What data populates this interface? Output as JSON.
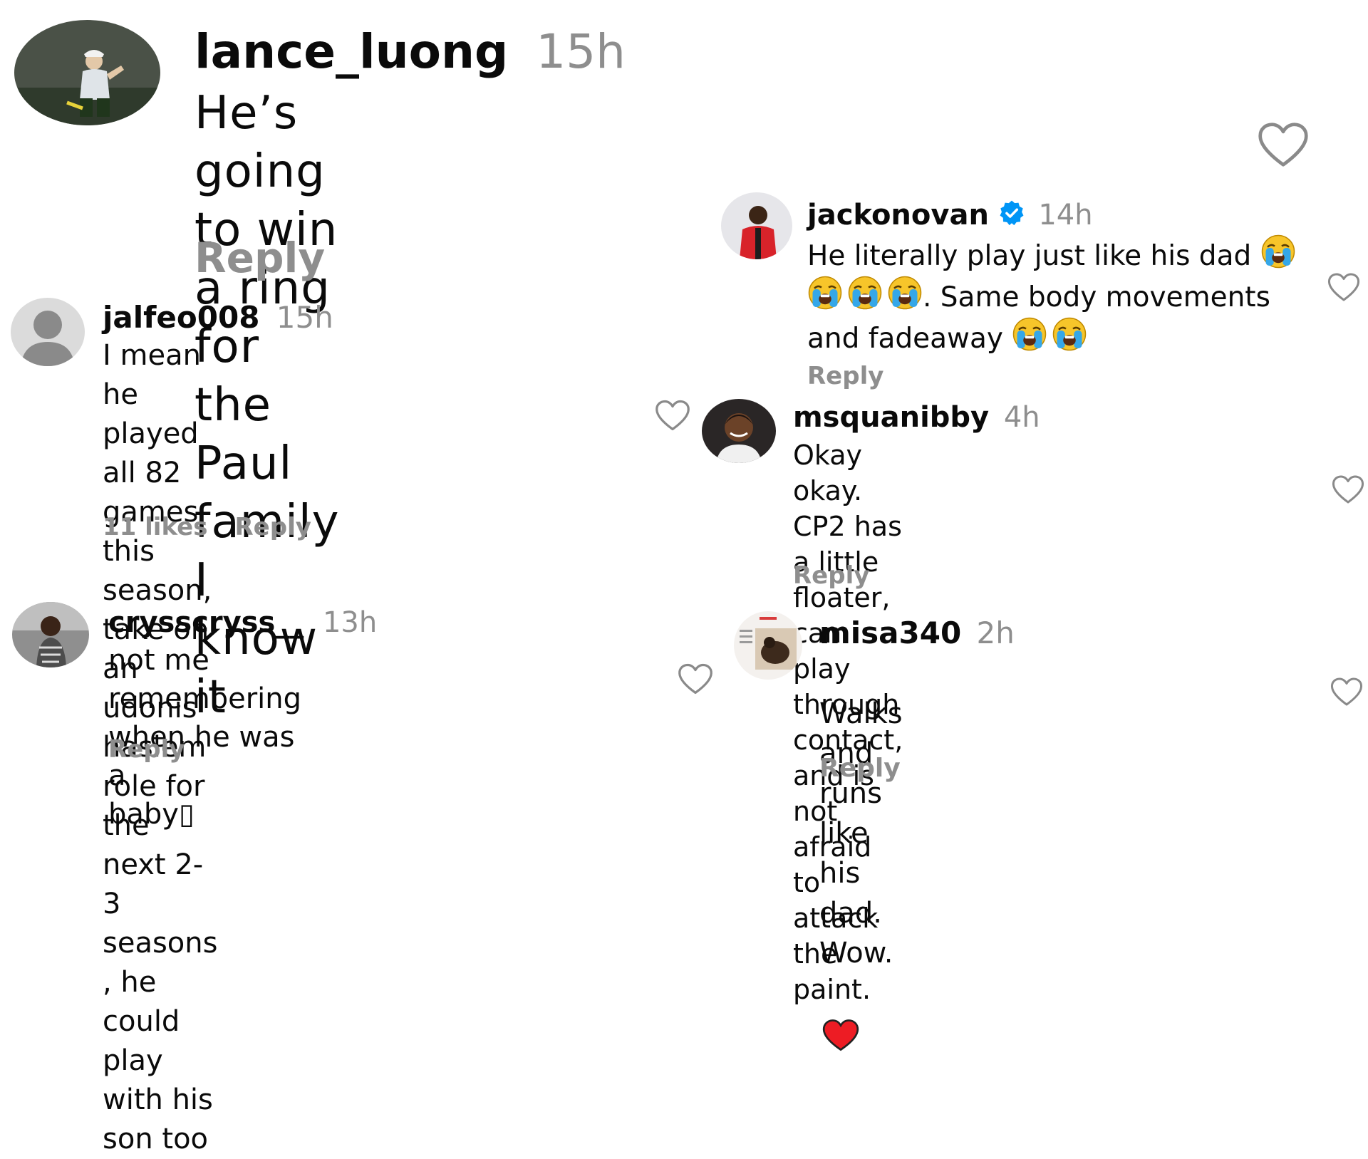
{
  "comments": [
    {
      "username": "lance_luong",
      "time": "15h",
      "text": "He’s going to win a ring for the Paul\nfamily I know it",
      "reply": "Reply"
    },
    {
      "username": "jackonovan",
      "time": "14h",
      "text_parts": [
        "He literally play just like his dad ",
        ". Same body movements",
        "and fadeaway "
      ],
      "reply": "Reply",
      "verified": true
    },
    {
      "username": "jalfeo008",
      "time": "15h",
      "text": "I mean he played all 82 games this\nseason, take on an udonis haslem\nrole for the next 2-3 seasons , he\ncould play with his son too",
      "likes": "11 likes",
      "reply": "Reply"
    },
    {
      "username": "msquanibby",
      "time": "4h",
      "text": "Okay okay. CP2 has a little floater,\ncan play through contact, and is not\nafraid to attack the paint.",
      "reply": "Reply"
    },
    {
      "username": "crysscryss__",
      "time": "13h",
      "text": "not me remembering when he was a\nbaby▯",
      "reply": "Reply"
    },
    {
      "username": "misa340",
      "time": "2h",
      "text": "Walks and runs like his dad. Wow.",
      "reply": "Reply"
    }
  ],
  "icons": {
    "heart": "heart-outline-icon",
    "verified": "verified-badge-icon",
    "crying_emoji": "loudly-crying-face-emoji",
    "red_heart_emoji": "red-heart-emoji"
  },
  "colors": {
    "username": "#0a0a0a",
    "muted": "#8e8e8e",
    "verified": "#0095f6",
    "heart_outline": "#8a8a8a",
    "red_heart": "#ed1c24"
  }
}
